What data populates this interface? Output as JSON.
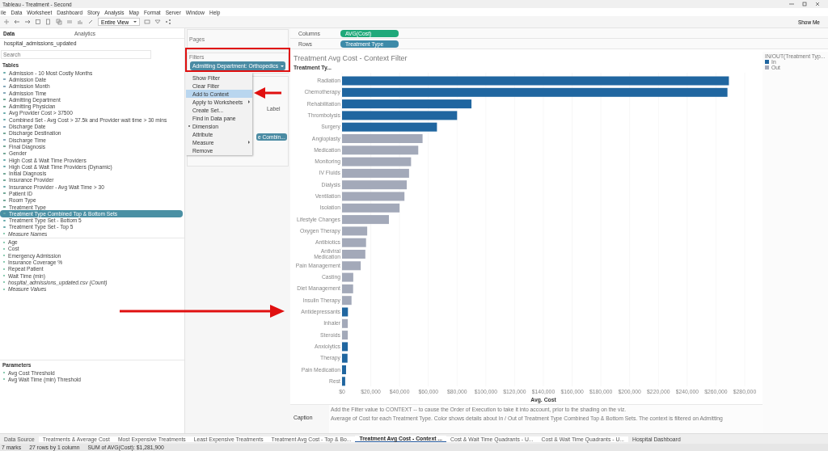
{
  "window": {
    "title": "Tableau - Treatment - Second"
  },
  "menu": [
    "ile",
    "Data",
    "Worksheet",
    "Dashboard",
    "Story",
    "Analysis",
    "Map",
    "Format",
    "Server",
    "Window",
    "Help"
  ],
  "toolbar": {
    "fit": "Entire View",
    "show_me": "Show Me"
  },
  "data_pane": {
    "tabs": [
      {
        "label": "Data",
        "selected": true
      },
      {
        "label": "Analytics",
        "selected": false
      }
    ],
    "source": "hospital_admissions_updated",
    "search": {
      "placeholder": "Search"
    },
    "tables_header": "Tables",
    "fields": [
      {
        "label": "Admission - 10 Most Costly Months",
        "kind": "set",
        "selected": false
      },
      {
        "label": "Admission Date",
        "kind": "date",
        "selected": false
      },
      {
        "label": "Admission Month",
        "kind": "date",
        "selected": false
      },
      {
        "label": "Admission Time",
        "kind": "date",
        "selected": false
      },
      {
        "label": "Admitting Department",
        "kind": "dimension",
        "selected": false
      },
      {
        "label": "Admitting Physician",
        "kind": "dimension",
        "selected": false
      },
      {
        "label": "Avg Provider Cost > 37500",
        "kind": "set",
        "selected": false
      },
      {
        "label": "Combined Set - Avg Cost > 37.5k and Provider wait time > 30 mins",
        "kind": "set",
        "selected": false
      },
      {
        "label": "Discharge Date",
        "kind": "date",
        "selected": false
      },
      {
        "label": "Discharge Destination",
        "kind": "dimension",
        "selected": false
      },
      {
        "label": "Discharge Time",
        "kind": "date",
        "selected": false
      },
      {
        "label": "Final Diagnosis",
        "kind": "dimension",
        "selected": false
      },
      {
        "label": "Gender",
        "kind": "dimension",
        "selected": false
      },
      {
        "label": "High Cost & Wait Time Providers",
        "kind": "set",
        "selected": false
      },
      {
        "label": "High Cost & Wait Time Providers (Dynamic)",
        "kind": "set",
        "selected": false
      },
      {
        "label": "Initial Diagnosis",
        "kind": "dimension",
        "selected": false
      },
      {
        "label": "Insurance Provider",
        "kind": "dimension",
        "selected": false
      },
      {
        "label": "Insurance Provider - Avg Wait Time > 30",
        "kind": "set",
        "selected": false
      },
      {
        "label": "Patient ID",
        "kind": "dimension",
        "selected": false
      },
      {
        "label": "Room Type",
        "kind": "dimension",
        "selected": false
      },
      {
        "label": "Treatment Type",
        "kind": "dimension",
        "selected": false
      },
      {
        "label": "Treatment Type Combined Top & Bottom Sets",
        "kind": "set",
        "selected": true
      },
      {
        "label": "Treatment Type Set - Bottom 5",
        "kind": "set",
        "selected": false
      },
      {
        "label": "Treatment Type Set - Top 5",
        "kind": "set",
        "selected": false
      },
      {
        "label": "Measure Names",
        "kind": "generated",
        "selected": false
      }
    ],
    "measures": [
      {
        "label": "Age",
        "kind": "measure"
      },
      {
        "label": "Cost",
        "kind": "measure"
      },
      {
        "label": "Emergency Admission",
        "kind": "measure"
      },
      {
        "label": "Insurance Coverage %",
        "kind": "measure"
      },
      {
        "label": "Repeat Patient",
        "kind": "measure"
      },
      {
        "label": "Wait Time (min)",
        "kind": "measure"
      },
      {
        "label": "hospital_admissions_updated.csv (Count)",
        "kind": "generated"
      },
      {
        "label": "Measure Values",
        "kind": "generated"
      }
    ],
    "parameters_header": "Parameters",
    "parameters": [
      "Avg Cost Threshold",
      "Avg Wait Time (min) Threshold"
    ]
  },
  "pages": {
    "title": "Pages"
  },
  "filters": {
    "title": "Filters",
    "pill": "Admitting Department: Orthopedics"
  },
  "marks": {
    "label_button": "Label",
    "pill": "e Combin..."
  },
  "context_menu": [
    {
      "label": "Show Filter",
      "selected": false,
      "submenu": false,
      "checked": false
    },
    {
      "label": "Clear Filter",
      "selected": false,
      "submenu": false,
      "checked": false
    },
    {
      "label": "Add to Context",
      "selected": true,
      "submenu": false,
      "checked": false
    },
    {
      "label": "Apply to Worksheets",
      "selected": false,
      "submenu": true,
      "checked": false
    },
    {
      "label": "Create Set...",
      "selected": false,
      "submenu": false,
      "checked": false
    },
    {
      "label": "Find in Data pane",
      "selected": false,
      "submenu": false,
      "checked": false
    },
    {
      "label": "Dimension",
      "selected": false,
      "submenu": false,
      "checked": true
    },
    {
      "label": "Attribute",
      "selected": false,
      "submenu": false,
      "checked": false
    },
    {
      "label": "Measure",
      "selected": false,
      "submenu": true,
      "checked": false
    },
    {
      "label": "Remove",
      "selected": false,
      "submenu": false,
      "checked": false
    }
  ],
  "shelves": [
    {
      "label": "Columns",
      "pill": "AVG(Cost)",
      "color": "#1fa97a"
    },
    {
      "label": "Rows",
      "pill": "Treatment Type",
      "color": "#3d8aa8"
    }
  ],
  "view": {
    "chart_data": {
      "type": "bar",
      "orientation": "horizontal",
      "grid": true,
      "title": "Treatment Avg Cost - Context Filter",
      "ylabel": "Treatment Ty...",
      "xlabel": "Avg. Cost",
      "categories": [
        "Radiation",
        "Chemotherapy",
        "Rehabilitation",
        "Thrombolysis",
        "Surgery",
        "Angioplasty",
        "Medication",
        "Monitoring",
        "IV Fluids",
        "Dialysis",
        "Ventilation",
        "Isolation",
        "Lifestyle Changes",
        "Oxygen Therapy",
        "Antibiotics",
        "Antiviral Medication",
        "Pain Management",
        "Casting",
        "Diet Management",
        "Insulin Therapy",
        "Antidepressants",
        "Inhaler",
        "Steroids",
        "Anxiolytics",
        "Therapy",
        "Pain Medication",
        "Rest"
      ],
      "series": [
        {
          "name": "In",
          "color": "#2066a0",
          "values": [
            269000,
            268000,
            90000,
            80000,
            66000,
            null,
            null,
            null,
            null,
            null,
            null,
            null,
            null,
            null,
            null,
            null,
            null,
            null,
            null,
            null,
            4100,
            null,
            null,
            4000,
            3800,
            2800,
            2200
          ]
        },
        {
          "name": "Out",
          "color": "#a3a9b9",
          "values": [
            null,
            null,
            null,
            null,
            null,
            56000,
            53000,
            48000,
            46600,
            45000,
            43400,
            40000,
            32600,
            17500,
            16700,
            16200,
            13000,
            7800,
            7700,
            6600,
            null,
            4000,
            4000,
            null,
            null,
            null,
            null
          ]
        }
      ],
      "xlim": [
        0,
        280000
      ],
      "xticks": [
        {
          "value": 0,
          "label": "$0"
        },
        {
          "value": 20000,
          "label": "$20,000"
        },
        {
          "value": 40000,
          "label": "$40,000"
        },
        {
          "value": 60000,
          "label": "$60,000"
        },
        {
          "value": 80000,
          "label": "$80,000"
        },
        {
          "value": 100000,
          "label": "$100,000"
        },
        {
          "value": 120000,
          "label": "$120,000"
        },
        {
          "value": 140000,
          "label": "$140,000"
        },
        {
          "value": 160000,
          "label": "$160,000"
        },
        {
          "value": 180000,
          "label": "$180,000"
        },
        {
          "value": 200000,
          "label": "$200,000"
        },
        {
          "value": 220000,
          "label": "$220,000"
        },
        {
          "value": 240000,
          "label": "$240,000"
        },
        {
          "value": 260000,
          "label": "$260,000"
        },
        {
          "value": 280000,
          "label": "$280,000"
        }
      ]
    }
  },
  "legend": {
    "title": "IN/OUT(Treatment Typ..."
  },
  "caption": {
    "label": "Caption",
    "lines": [
      "Add the Filter value to CONTEXT -- to cause the Order of Execution to take it into account, prior to the shading on the viz.",
      "Average of Cost for each Treatment Type.  Color shows details about In / Out of Treatment Type Combined Top & Bottom Sets. The context is filtered on Admitting"
    ]
  },
  "sheet_tabs": [
    {
      "label": "Data Source",
      "kind": "source",
      "selected": false
    },
    {
      "label": "Treatments & Average Cost",
      "kind": "sheet",
      "selected": false
    },
    {
      "label": "Most Expensive Treatments",
      "kind": "sheet",
      "selected": false
    },
    {
      "label": "Least Expensive Treatments",
      "kind": "sheet",
      "selected": false
    },
    {
      "label": "Treatment Avg Cost - Top & Bo...",
      "kind": "sheet",
      "selected": false
    },
    {
      "label": "Treatment Avg Cost - Context ...",
      "kind": "sheet",
      "selected": true
    },
    {
      "label": "Cost & Wait Time Quadrants - U...",
      "kind": "sheet",
      "selected": false
    },
    {
      "label": "Cost & Wait Time Quadrants - U...",
      "kind": "sheet",
      "selected": false
    },
    {
      "label": "Hospital Dashboard",
      "kind": "dashboard",
      "selected": false
    }
  ],
  "status_bar": [
    "7 marks",
    "27 rows by 1 column",
    "SUM of AVG(Cost): $1,281,900"
  ]
}
